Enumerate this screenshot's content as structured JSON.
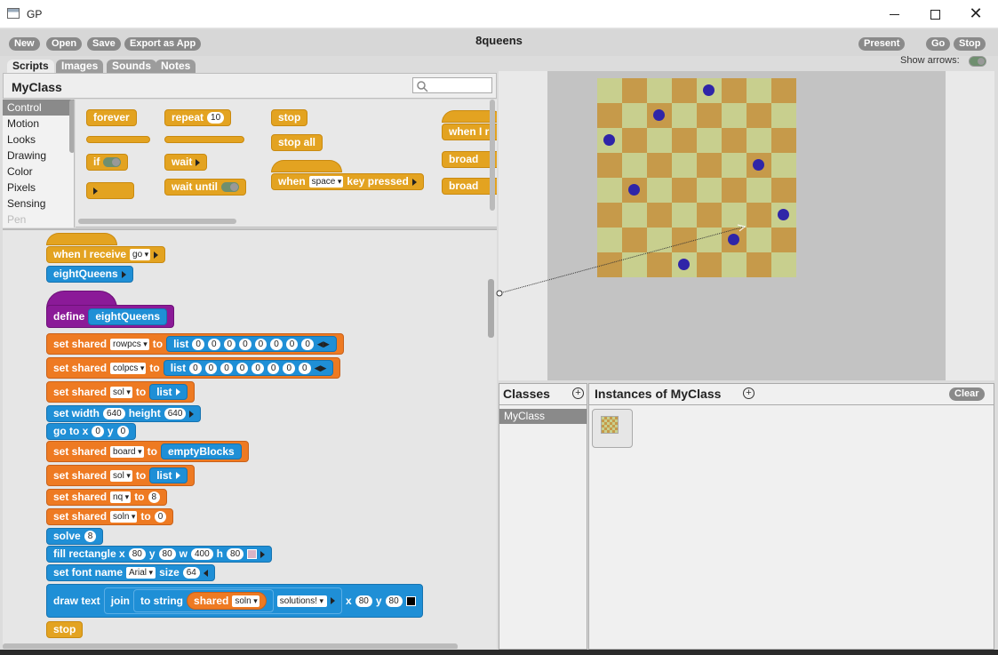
{
  "window": {
    "title": "GP"
  },
  "toolbar": {
    "new_label": "New",
    "open_label": "Open",
    "save_label": "Save",
    "export_label": "Export as App",
    "present_label": "Present",
    "go_label": "Go",
    "stop_label": "Stop",
    "project_name": "8queens",
    "show_arrows_label": "Show arrows:"
  },
  "tabs": [
    "Scripts",
    "Images",
    "Sounds",
    "Notes"
  ],
  "class_header": {
    "name": "MyClass"
  },
  "categories": [
    "Control",
    "Motion",
    "Looks",
    "Drawing",
    "Color",
    "Pixels",
    "Sensing",
    "Pen"
  ],
  "palette": {
    "forever": "forever",
    "repeat": "repeat",
    "repeat_count": "10",
    "stop": "stop",
    "stop_all": "stop all",
    "when_i": "when I r",
    "if": "if",
    "wait": "wait",
    "wait_until": "wait until",
    "when": "when",
    "key": "space",
    "key_pressed": "key pressed",
    "broadcast1": "broad",
    "broadcast2": "broad"
  },
  "scripts": {
    "when_receive": "when I receive",
    "receive_msg": "go",
    "eightqueens_call": "eightQueens",
    "define": "define",
    "define_name": "eightQueens",
    "set_shared": "set shared",
    "to": "to",
    "list": "list",
    "var_rowpcs": "rowpcs",
    "var_colpcs": "colpcs",
    "var_sol": "sol",
    "var_board": "board",
    "var_nq": "nq",
    "var_soln": "soln",
    "zeros": [
      "0",
      "0",
      "0",
      "0",
      "0",
      "0",
      "0",
      "0"
    ],
    "set_width": "set width",
    "width_val": "640",
    "height": "height",
    "height_val": "640",
    "goto": "go to x",
    "goto_x": "0",
    "y": "y",
    "goto_y": "0",
    "emptyblocks": "emptyBlocks",
    "nq_val": "8",
    "soln_val": "0",
    "solve": "solve",
    "solve_val": "8",
    "fill_rect": "fill rectangle x",
    "fr_x": "80",
    "fr_y": "80",
    "w": "w",
    "fr_w": "400",
    "h": "h",
    "fr_h": "80",
    "set_font": "set font name",
    "font_name": "Arial",
    "size": "size",
    "font_size": "64",
    "draw_text": "draw text",
    "join": "join",
    "to_string": "to string",
    "shared": "shared",
    "solutions": "solutions!",
    "x": "x",
    "dt_x": "80",
    "dt_y": "80",
    "stop": "stop"
  },
  "board": {
    "size": 8,
    "light": "#c8cf8e",
    "dark": "#c69a4a",
    "queen_color": "#2f25a8",
    "queens": [
      [
        0,
        4
      ],
      [
        1,
        2
      ],
      [
        2,
        0
      ],
      [
        3,
        6
      ],
      [
        4,
        1
      ],
      [
        5,
        7
      ],
      [
        6,
        5
      ],
      [
        7,
        3
      ]
    ]
  },
  "classes_panel": {
    "title": "Classes",
    "items": [
      "MyClass"
    ]
  },
  "instances_panel": {
    "title": "Instances of MyClass",
    "clear_label": "Clear"
  }
}
